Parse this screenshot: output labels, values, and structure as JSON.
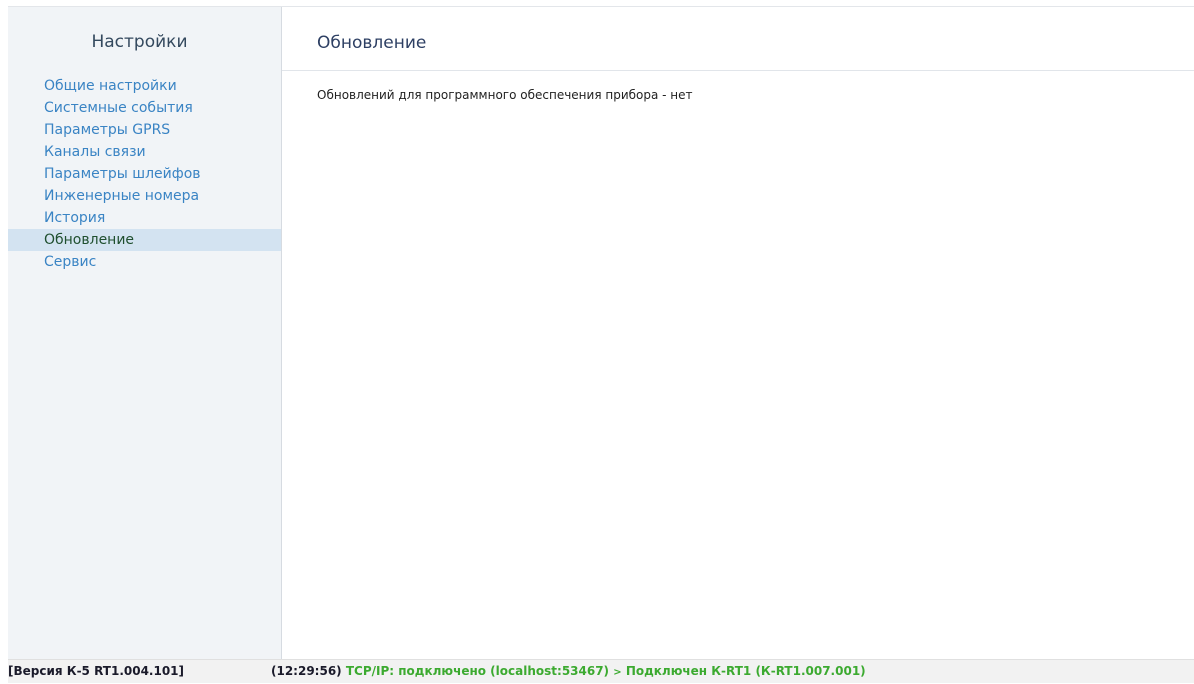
{
  "sidebar": {
    "title": "Настройки",
    "items": [
      {
        "label": "Общие настройки"
      },
      {
        "label": "Системные события"
      },
      {
        "label": "Параметры GPRS"
      },
      {
        "label": "Каналы связи"
      },
      {
        "label": "Параметры шлейфов"
      },
      {
        "label": "Инженерные номера"
      },
      {
        "label": "История"
      },
      {
        "label": "Обновление",
        "active": true
      },
      {
        "label": "Сервис"
      }
    ]
  },
  "main": {
    "title": "Обновление",
    "message": "Обновлений для программного обеспечения прибора - нет"
  },
  "statusbar": {
    "version": "[Версия К-5 RT1.004.101]",
    "time": "(12:29:56)",
    "tcp": "TCP/IP: подключено (localhost:53467)",
    "arrow": ">",
    "device": "Подключен К-RT1 (К-RT1.007.001)"
  },
  "colors": {
    "sidebar_bg": "#f1f4f7",
    "link": "#3a84c4",
    "active_bg": "#d3e3f1",
    "status_green": "#3caa30"
  }
}
